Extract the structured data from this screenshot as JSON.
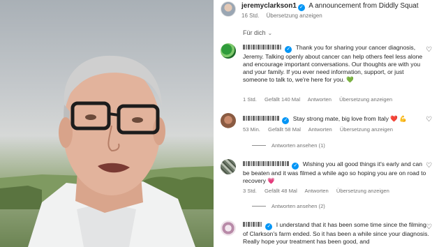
{
  "caption": {
    "username": "jeremyclarkson1",
    "text": "A announcement from Diddly Squat",
    "time": "16 Std.",
    "translate": "Übersetzung anzeigen"
  },
  "sort": {
    "label": "Für dich",
    "icon": "chevron-down-icon"
  },
  "comments": [
    {
      "text": "Thank you for sharing your cancer diagnosis, Jeremy. Talking openly about cancer can help others feel less alone and encourage important conversations. Our thoughts are with you and your family. If you ever need information, support, or just someone to talk to, we're here for you.",
      "emoji": "💚",
      "time": "1 Std.",
      "likes": "Gefällt 140 Mal",
      "reply": "Antworten",
      "translate": "Übersetzung anzeigen"
    },
    {
      "text": "Stay strong mate, big love from Italy",
      "emoji": "❤️",
      "emoji2": "💪",
      "time": "53 Min.",
      "likes": "Gefällt 58 Mal",
      "reply": "Antworten",
      "translate": "Übersetzung anzeigen",
      "replies": "Antworten ansehen (1)"
    },
    {
      "text": "Wishing you all good things it's early and can be beaten and it was filmed a while ago so hoping you are on road to recovery",
      "emoji": "💗",
      "time": "3 Std.",
      "likes": "Gefällt 48 Mal",
      "reply": "Antworten",
      "translate": "Übersetzung anzeigen",
      "replies": "Antworten ansehen (2)"
    },
    {
      "text": "I understand that it has been some time since the filming of Clarkson's farm ended. So it has been a while since your diagnosis. Really hope your treatment has been good, and"
    }
  ],
  "colors": {
    "verified": "#0095f6",
    "meta": "#737373",
    "text": "#262626"
  }
}
